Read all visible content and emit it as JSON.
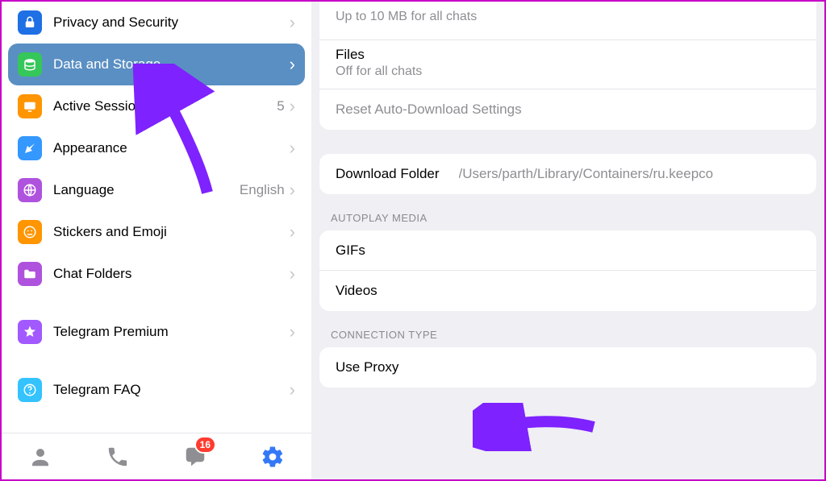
{
  "sidebar": {
    "items": [
      {
        "label": "Privacy and Security",
        "value": "",
        "iconBg": "#1f6fe5",
        "icon": "lock"
      },
      {
        "label": "Data and Storage",
        "value": "",
        "iconBg": "#35c759",
        "icon": "storage",
        "active": true
      },
      {
        "label": "Active Sessions",
        "value": "5",
        "iconBg": "#ff9500",
        "icon": "sessions"
      },
      {
        "label": "Appearance",
        "value": "",
        "iconBg": "#3498ff",
        "icon": "appearance"
      },
      {
        "label": "Language",
        "value": "English",
        "iconBg": "#af52de",
        "icon": "globe"
      },
      {
        "label": "Stickers and Emoji",
        "value": "",
        "iconBg": "#ff9500",
        "icon": "sticker"
      },
      {
        "label": "Chat Folders",
        "value": "",
        "iconBg": "#af52de",
        "icon": "folder"
      },
      {
        "label": "Telegram Premium",
        "value": "",
        "iconBg": "#a259ff",
        "icon": "star"
      },
      {
        "label": "Telegram FAQ",
        "value": "",
        "iconBg": "#34c3ff",
        "icon": "faq"
      }
    ]
  },
  "tabbar": {
    "chatBadge": "16"
  },
  "content": {
    "autoDownload": {
      "uploadLimit": "Up to 10 MB for all chats",
      "filesTitle": "Files",
      "filesSub": "Off for all chats",
      "reset": "Reset Auto-Download Settings"
    },
    "downloadFolder": {
      "label": "Download Folder",
      "path": "/Users/parth/Library/Containers/ru.keepco"
    },
    "autoplay": {
      "header": "AUTOPLAY MEDIA",
      "gifs": "GIFs",
      "videos": "Videos"
    },
    "connection": {
      "header": "CONNECTION TYPE",
      "useProxy": "Use Proxy"
    }
  }
}
